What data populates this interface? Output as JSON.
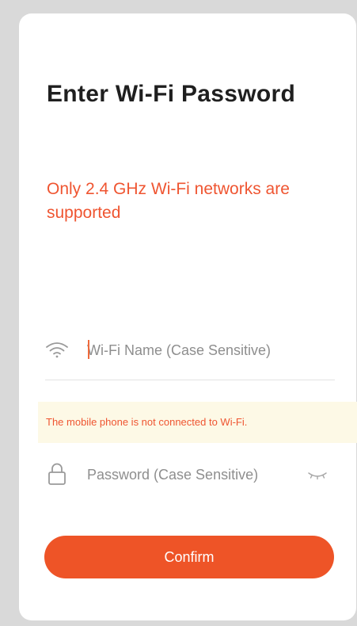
{
  "header": {
    "title": "Enter Wi-Fi Password"
  },
  "warning": {
    "text": "Only 2.4 GHz Wi-Fi networks are supported"
  },
  "ssid_field": {
    "icon": "wifi-icon",
    "value": "",
    "placeholder": "Wi-Fi Name (Case Sensitive)"
  },
  "notice": {
    "text": "The mobile phone is not connected to Wi-Fi."
  },
  "password_field": {
    "icon": "lock-icon",
    "value": "",
    "placeholder": "Password (Case Sensitive)",
    "toggle_icon": "eye-closed-icon"
  },
  "actions": {
    "confirm_label": "Confirm"
  },
  "colors": {
    "accent": "#ee5427",
    "warning_text": "#ef5531",
    "notice_bg": "#fdf9e6",
    "page_bg": "#d9d9d9"
  }
}
